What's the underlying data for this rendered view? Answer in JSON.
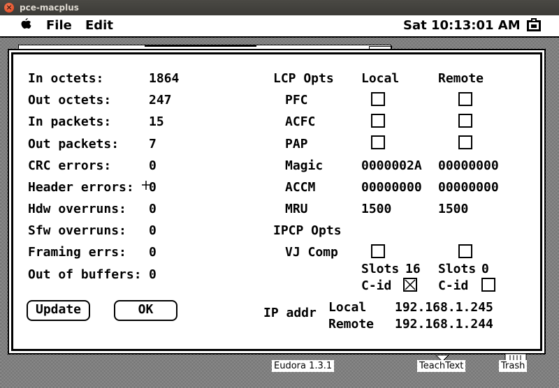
{
  "window": {
    "title": "pce-macplus"
  },
  "menubar": {
    "items": [
      "File",
      "Edit"
    ],
    "clock": "Sat 10:13:01 AM"
  },
  "stats": [
    {
      "label": "In octets:",
      "value": "1864"
    },
    {
      "label": "Out octets:",
      "value": "247"
    },
    {
      "label": "In packets:",
      "value": "15"
    },
    {
      "label": "Out packets:",
      "value": "7"
    },
    {
      "label": "CRC errors:",
      "value": "0"
    },
    {
      "label": "Header errors:",
      "value": "0"
    },
    {
      "label": "Hdw overruns:",
      "value": "0"
    },
    {
      "label": "Sfw overruns:",
      "value": "0"
    },
    {
      "label": "Framing errs:",
      "value": "0"
    },
    {
      "label": "Out of buffers:",
      "value": "0"
    }
  ],
  "lcp": {
    "heading": "LCP Opts",
    "local_header": "Local",
    "remote_header": "Remote",
    "pfc": "PFC",
    "acfc": "ACFC",
    "pap": "PAP",
    "magic": {
      "label": "Magic",
      "local": "0000002A",
      "remote": "00000000"
    },
    "accm": {
      "label": "ACCM",
      "local": "00000000",
      "remote": "00000000"
    },
    "mru": {
      "label": "MRU",
      "local": "1500",
      "remote": "1500"
    },
    "checks": {
      "pfc_local": false,
      "pfc_remote": false,
      "acfc_local": false,
      "acfc_remote": false,
      "pap_local": false,
      "pap_remote": false
    }
  },
  "ipcp": {
    "heading": "IPCP Opts",
    "vj_comp": "VJ Comp",
    "slots_label": "Slots",
    "local_slots": "16",
    "remote_slots": "0",
    "cid_label": "C-id",
    "checks": {
      "vj_local": false,
      "vj_remote": false,
      "cid_local": true,
      "cid_remote": false
    }
  },
  "ip": {
    "label": "IP addr",
    "local_label": "Local",
    "local": "192.168.1.245",
    "remote_label": "Remote",
    "remote": "192.168.1.244"
  },
  "buttons": {
    "update": "Update",
    "ok": "OK"
  },
  "desktop": {
    "icons": [
      {
        "label": "Eudora 1.3.1"
      },
      {
        "label": "TeachText"
      },
      {
        "label": "Trash"
      }
    ]
  }
}
